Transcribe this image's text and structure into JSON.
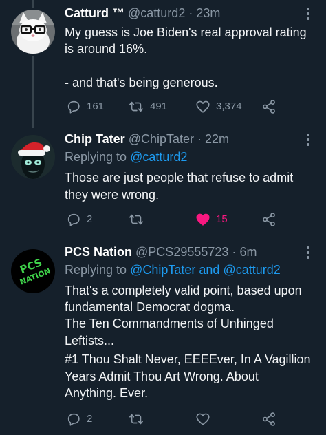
{
  "colors": {
    "background": "#15202b",
    "thread_line": "#38444d",
    "secondary_text": "#8b98a5",
    "mention": "#1d9bf0",
    "like_active": "#f91880"
  },
  "tweets": [
    {
      "name": "Catturd ™",
      "handle": "@catturd2",
      "separator": "·",
      "time": "23m",
      "lines": [
        "My guess is Joe Biden's real approval rating",
        "is around 16%.",
        "",
        "- and that's being generous."
      ],
      "replies": "161",
      "retweets": "491",
      "likes": "3,374",
      "liked": false,
      "avatar_icon": "cat-with-glasses-avatar"
    },
    {
      "name": "Chip Tater",
      "handle": "@ChipTater",
      "separator": "·",
      "time": "22m",
      "replying_label": "Replying to",
      "replying_to": [
        "@catturd2"
      ],
      "lines": [
        "Those are just people that refuse to admit",
        "they were wrong."
      ],
      "replies": "2",
      "retweets": "",
      "likes": "15",
      "liked": true,
      "avatar_icon": "alien-santa-hat-avatar"
    },
    {
      "name": "PCS Nation",
      "handle": "@PCS29555723",
      "separator": "·",
      "time": "6m",
      "replying_label": "Replying to",
      "replying_to": [
        "@ChipTater",
        "and",
        "@catturd2"
      ],
      "lines": [
        "That's a completely valid point, based upon",
        "fundamental Democrat dogma.",
        "The Ten Commandments of Unhinged",
        "Leftists...",
        "#1 Thou Shalt Never, EEEEver, In A Vagillion",
        "Years Admit Thou Art Wrong. About",
        "Anything. Ever."
      ],
      "replies": "2",
      "retweets": "",
      "likes": "",
      "liked": false,
      "avatar_icon": "pcs-nation-logo-avatar",
      "avatar_text": [
        "PCS",
        "NATION"
      ]
    }
  ]
}
